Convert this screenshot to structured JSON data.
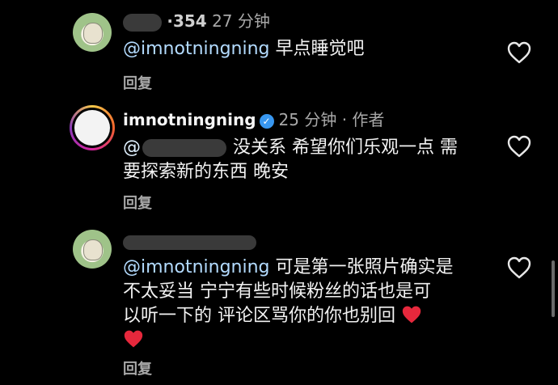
{
  "colors": {
    "background": "#000000",
    "text": "#f2f2f2",
    "secondary_text": "#a8a8a8",
    "mention": "#b3dbff",
    "verified_badge": "#3897f0",
    "heart_emoji": "#e6283c"
  },
  "comments": [
    {
      "username_partial": "·354",
      "time": "27 分钟",
      "mention": "@imnotningning",
      "text": " 早点睡觉吧",
      "reply_label": "回复",
      "avatar_icon": "green-cartoon-avatar",
      "like_icon": "heart-outline-icon"
    },
    {
      "username": "imnotningning",
      "verified_icon": "verified-check-icon",
      "time": "25 分钟",
      "separator": "·",
      "author_tag": "作者",
      "mention": "@",
      "text_line1": "没关系 希望你们乐观一点 需",
      "text_line2": "要探索新的东西 晚安",
      "reply_label": "回复",
      "avatar_icon": "story-ring-avatar",
      "like_icon": "heart-outline-icon"
    },
    {
      "mention": "@imnotningning",
      "text_line1": " 可是第一张照片确实是",
      "text_line2": "不太妥当 宁宁有些时候粉丝的话也是可",
      "text_line3": "以听一下的 评论区骂你的你也别回",
      "emoji": "red-heart-emoji",
      "reply_label": "回复",
      "avatar_icon": "green-cartoon-avatar",
      "like_icon": "heart-outline-icon"
    }
  ]
}
